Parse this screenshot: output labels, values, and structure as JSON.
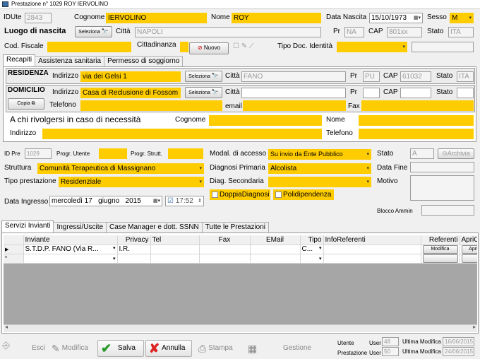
{
  "window": {
    "title": "Prestazione n° 1029 ROY IERVOLINO"
  },
  "top": {
    "idute_label": "IDUte",
    "idute": "2843",
    "cognome_label": "Cognome",
    "cognome": "IERVOLINO",
    "nome_label": "Nome",
    "nome": "ROY",
    "nascita_label": "Data Nascita",
    "nascita": "15/10/1973",
    "sesso_label": "Sesso",
    "sesso": "M",
    "luogo_label": "Luogo di nascita",
    "seleziona": "Seleziona",
    "citta_label": "Città",
    "citta": "NAPOLI",
    "pr_label": "Pr",
    "pr": "NA",
    "cap_label": "CAP",
    "cap": "801xx",
    "stato_label": "Stato",
    "stato": "ITA",
    "cf_label": "Cod. Fiscale",
    "cittadinanza_label": "Cittadinanza",
    "nuovo": "Nuovo",
    "tipodoc_label": "Tipo Doc. Identità"
  },
  "tabs": [
    "Recapiti",
    "Assistenza sanitaria",
    "Permesso di soggiorno"
  ],
  "residenza": {
    "title": "RESIDENZA",
    "ind_label": "Indirizzo",
    "ind": "via dei Gelsi 1",
    "seleziona": "Seleziona",
    "citta_label": "Città",
    "citta": "FANO",
    "pr_label": "Pr",
    "pr": "PU",
    "cap_label": "CAP",
    "cap": "61032",
    "stato_label": "Stato",
    "stato": "ITA"
  },
  "domicilio": {
    "title": "DOMICILIO",
    "ind_label": "Indirizzo",
    "ind": "Casa di Reclusione di Fossom",
    "seleziona": "Seleziona",
    "citta_label": "Città",
    "pr_label": "Pr",
    "cap_label": "CAP",
    "stato_label": "Stato",
    "copia": "Copia",
    "tel_label": "Telefono",
    "email_label": "email",
    "fax_label": "Fax"
  },
  "emergenza": {
    "title": "A chi rivolgersi in caso di necessità",
    "cognome_label": "Cognome",
    "nome_label": "Nome",
    "ind_label": "Indirizzo",
    "tel_label": "Telefono"
  },
  "pratica": {
    "idpre_label": "ID Pre",
    "idpre": "1029",
    "prog_ut_label": "Progr. Utente",
    "prog_str_label": "Progr. Strutt.",
    "struttura_label": "Struttura",
    "struttura": "Comunità Terapeutica di Massignano",
    "tipo_label": "Tipo prestazione",
    "tipo": "Residenziale",
    "ingresso_label": "Data Ingresso",
    "ingresso_day": "mercoledì 17",
    "ingresso_month": "giugno",
    "ingresso_year": "2015",
    "ora": "17:52",
    "accesso_label": "Modal. di accesso",
    "accesso": "Su invio da Ente Pubblico",
    "diagp_label": "Diagnosi Primaria",
    "diagp": "Alcolista",
    "diags_label": "Diag. Secondaria",
    "doppia": "DoppiaDiagnosi",
    "poli": "Polidipendenza",
    "stato_label": "Stato",
    "stato": "A",
    "archivia": "Archivia",
    "datafine_label": "Data Fine",
    "motivo_label": "Motivo",
    "blocco_label": "Blocco Ammin"
  },
  "tabs2": [
    "Servizi Invianti",
    "Ingressi/Uscite",
    "Case Manager e dott. SSNN",
    "Tutte le Prestazioni"
  ],
  "grid": {
    "headers": [
      "Inviante",
      "Privacy",
      "Tel",
      "Fax",
      "EMail",
      "Tipo",
      "InfoReferenti",
      "Referenti",
      "ApriC"
    ],
    "row": {
      "inviante": "S.T.D.P.  FANO (Via R...",
      "privacy": "I.R.",
      "tipo": "C...",
      "modifica": "Modifica",
      "apri": "ApriC"
    }
  },
  "toolbar": {
    "esci": "Esci",
    "modifica": "Modifica",
    "salva": "Salva",
    "annulla": "Annulla",
    "stampa": "Stampa",
    "gestione": "Gestione"
  },
  "footer": {
    "utente_label": "Utente",
    "prest_label": "Prestazione",
    "user_label": "User",
    "utente_user": "48",
    "prest_user": "50",
    "ult_label": "Ultima Modifica",
    "utente_date": "16/06/2015",
    "prest_date": "24/06/2015"
  }
}
